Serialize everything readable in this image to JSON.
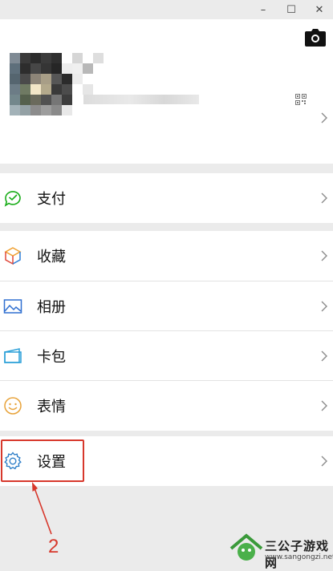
{
  "window": {
    "minimize": "–",
    "maximize": "☐",
    "close": "✕"
  },
  "menu": {
    "items": [
      {
        "label": "支付",
        "icon": "wallet-icon"
      },
      {
        "label": "收藏",
        "icon": "favorites-cube-icon"
      },
      {
        "label": "相册",
        "icon": "photo-album-icon"
      },
      {
        "label": "卡包",
        "icon": "card-package-icon"
      },
      {
        "label": "表情",
        "icon": "smiley-icon"
      },
      {
        "label": "设置",
        "icon": "gear-icon"
      }
    ]
  },
  "annotation": {
    "step_number": "2",
    "color": "#d7382c"
  },
  "watermark": {
    "text": "三公子游戏网",
    "url": "www.sangongzi.net"
  },
  "colors": {
    "accent_green": "#1aad19",
    "background": "#ebebeb"
  }
}
